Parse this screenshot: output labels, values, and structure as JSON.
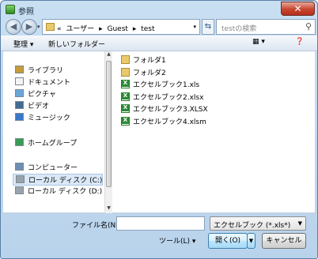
{
  "window": {
    "title": "参照",
    "close_glyph": "✕"
  },
  "nav": {
    "back_glyph": "◀",
    "forward_glyph": "▶",
    "address": {
      "prefix": "«",
      "crumbs": [
        "ユーザー",
        "Guest",
        "test"
      ],
      "separator": "▸"
    },
    "search_placeholder": "testの検索",
    "search_icon": "magnifier-icon"
  },
  "toolbar": {
    "organize": "整理 ▾",
    "new_folder": "新しいフォルダー",
    "view_glyph": "▦ ▾",
    "help_glyph": "❓"
  },
  "sidebar": [
    {
      "label": "ライブラリ",
      "icon": "library-icon",
      "color": "#c69b3a"
    },
    {
      "label": "ドキュメント",
      "icon": "document-icon",
      "color": "#f4f4f4"
    },
    {
      "label": "ピクチャ",
      "icon": "picture-icon",
      "color": "#6aa6d8"
    },
    {
      "label": "ビデオ",
      "icon": "video-icon",
      "color": "#446b92"
    },
    {
      "label": "ミュージック",
      "icon": "music-icon",
      "color": "#3a78c9"
    },
    {
      "label": "ホームグループ",
      "icon": "homegroup-icon",
      "color": "#3a9b55"
    },
    {
      "label": "コンピューター",
      "icon": "computer-icon",
      "color": "#6f8fb3"
    },
    {
      "label": "ローカル ディスク (C:)",
      "icon": "drive-c-icon",
      "color": "#9aa3ad",
      "selected": true
    },
    {
      "label": "ローカル ディスク (D:)",
      "icon": "drive-d-icon",
      "color": "#9aa3ad"
    }
  ],
  "files": [
    {
      "name": "フォルダ1",
      "type": "folder"
    },
    {
      "name": "フォルダ2",
      "type": "folder"
    },
    {
      "name": "エクセルブック1.xls",
      "type": "excel"
    },
    {
      "name": "エクセルブック2.xlsx",
      "type": "excel"
    },
    {
      "name": "エクセルブック3.XLSX",
      "type": "excel"
    },
    {
      "name": "エクセルブック4.xlsm",
      "type": "excel"
    }
  ],
  "bottom": {
    "filename_label": "ファイル名(N):",
    "filename_value": "",
    "file_type": "エクセルブック (*.xls*)",
    "tools": "ツール(L) ▾",
    "open": "開く(O)",
    "cancel": "キャンセル"
  }
}
